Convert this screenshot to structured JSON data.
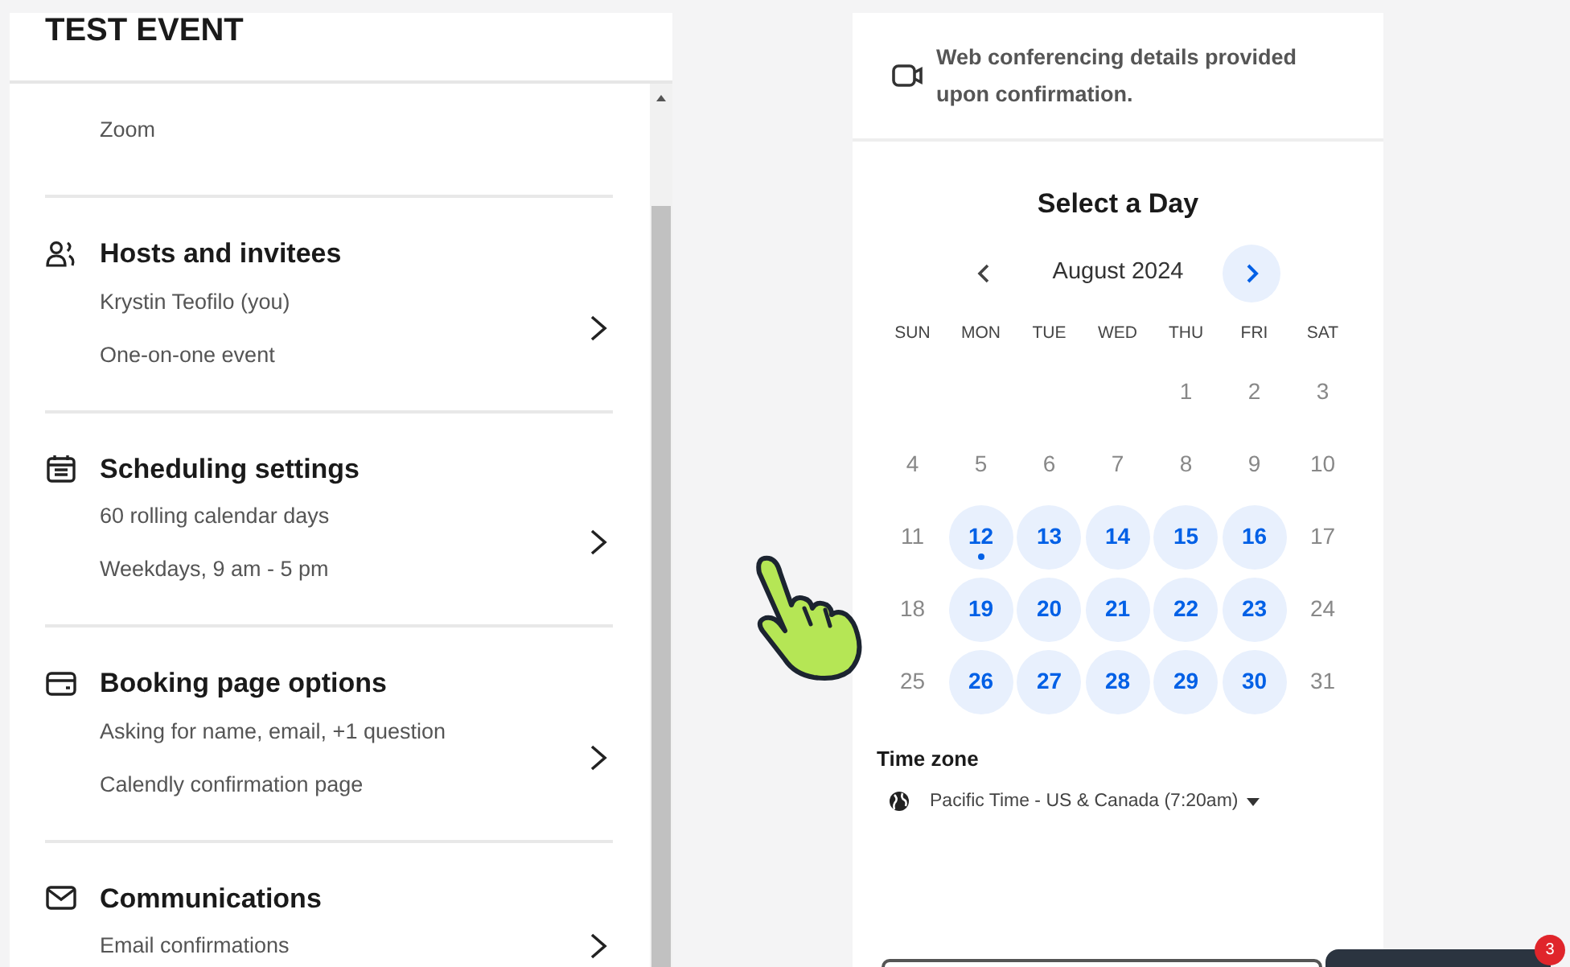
{
  "event_panel": {
    "title": "TEST EVENT",
    "sections": [
      {
        "lines": [
          "Zoom"
        ]
      },
      {
        "kind": "people",
        "title": "Hosts and invitees",
        "lines": [
          "Krystin Teofilo (you)",
          "One-on-one event"
        ]
      },
      {
        "kind": "calendar",
        "title": "Scheduling settings",
        "lines": [
          "60 rolling calendar days",
          "Weekdays, 9 am - 5 pm"
        ]
      },
      {
        "kind": "card",
        "title": "Booking page options",
        "lines": [
          "Asking for name, email, +1 question",
          "Calendly confirmation page"
        ]
      },
      {
        "kind": "mail",
        "title": "Communications",
        "lines": [
          "Email confirmations"
        ]
      }
    ]
  },
  "preview": {
    "conferencing_note": "Web conferencing details provided upon confirmation.",
    "calendar": {
      "title": "Select a Day",
      "month": "August 2024",
      "next_enabled": true,
      "weekdays": [
        "SUN",
        "MON",
        "TUE",
        "WED",
        "THU",
        "FRI",
        "SAT"
      ],
      "weeks": [
        [
          {
            "kind": "blank"
          },
          {
            "kind": "blank"
          },
          {
            "kind": "blank"
          },
          {
            "kind": "blank"
          },
          {
            "kind": "day",
            "label": "1",
            "available": false,
            "today": false
          },
          {
            "kind": "day",
            "label": "2",
            "available": false,
            "today": false
          },
          {
            "kind": "day",
            "label": "3",
            "available": false,
            "today": false
          }
        ],
        [
          {
            "kind": "day",
            "label": "4",
            "available": false,
            "today": false
          },
          {
            "kind": "day",
            "label": "5",
            "available": false,
            "today": false
          },
          {
            "kind": "day",
            "label": "6",
            "available": false,
            "today": false
          },
          {
            "kind": "day",
            "label": "7",
            "available": false,
            "today": false
          },
          {
            "kind": "day",
            "label": "8",
            "available": false,
            "today": false
          },
          {
            "kind": "day",
            "label": "9",
            "available": false,
            "today": false
          },
          {
            "kind": "day",
            "label": "10",
            "available": false,
            "today": false
          }
        ],
        [
          {
            "kind": "day",
            "label": "11",
            "available": false,
            "today": false
          },
          {
            "kind": "day",
            "label": "12",
            "available": true,
            "today": true
          },
          {
            "kind": "day",
            "label": "13",
            "available": true,
            "today": false
          },
          {
            "kind": "day",
            "label": "14",
            "available": true,
            "today": false
          },
          {
            "kind": "day",
            "label": "15",
            "available": true,
            "today": false
          },
          {
            "kind": "day",
            "label": "16",
            "available": true,
            "today": false
          },
          {
            "kind": "day",
            "label": "17",
            "available": false,
            "today": false
          }
        ],
        [
          {
            "kind": "day",
            "label": "18",
            "available": false,
            "today": false
          },
          {
            "kind": "day",
            "label": "19",
            "available": true,
            "today": false
          },
          {
            "kind": "day",
            "label": "20",
            "available": true,
            "today": false
          },
          {
            "kind": "day",
            "label": "21",
            "available": true,
            "today": false
          },
          {
            "kind": "day",
            "label": "22",
            "available": true,
            "today": false
          },
          {
            "kind": "day",
            "label": "23",
            "available": true,
            "today": false
          },
          {
            "kind": "day",
            "label": "24",
            "available": false,
            "today": false
          }
        ],
        [
          {
            "kind": "day",
            "label": "25",
            "available": false,
            "today": false
          },
          {
            "kind": "day",
            "label": "26",
            "available": true,
            "today": false
          },
          {
            "kind": "day",
            "label": "27",
            "available": true,
            "today": false
          },
          {
            "kind": "day",
            "label": "28",
            "available": true,
            "today": false
          },
          {
            "kind": "day",
            "label": "29",
            "available": true,
            "today": false
          },
          {
            "kind": "day",
            "label": "30",
            "available": true,
            "today": false
          },
          {
            "kind": "day",
            "label": "31",
            "available": false,
            "today": false
          }
        ]
      ]
    },
    "time_zone": {
      "label": "Time zone",
      "value": "Pacific Time - US & Canada (7:20am)"
    }
  },
  "chat_badge": "3"
}
